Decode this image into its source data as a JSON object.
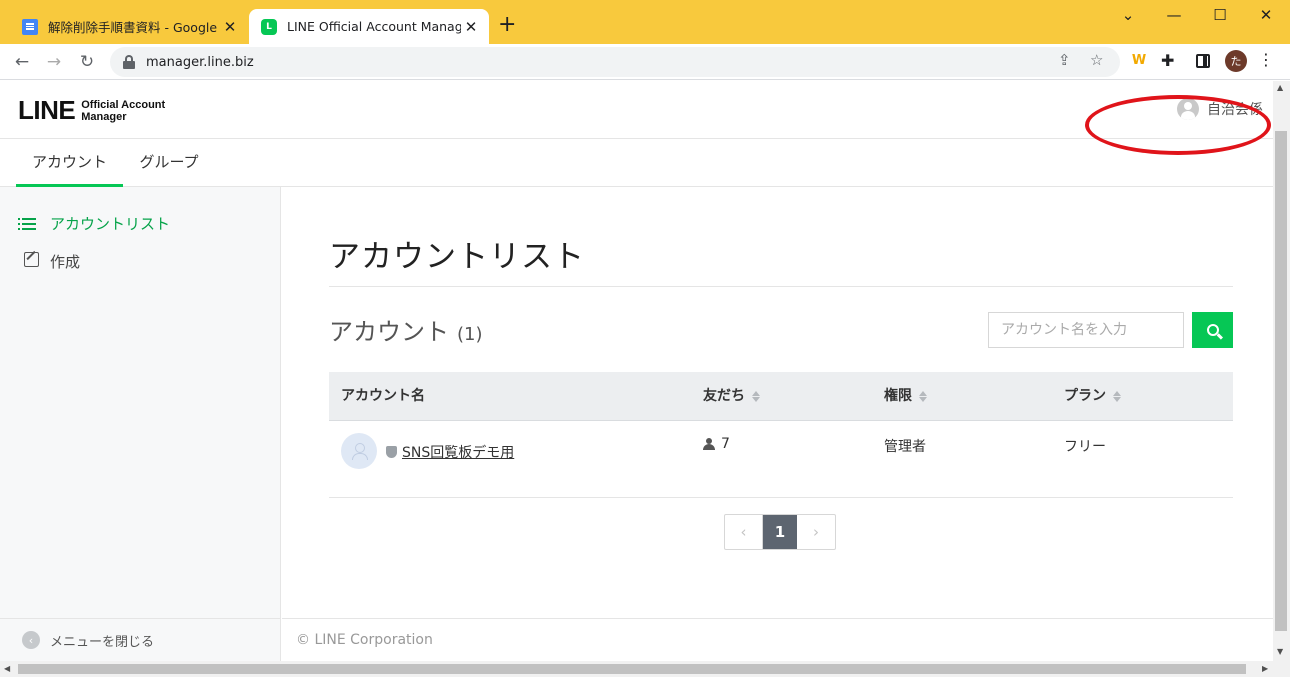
{
  "browser": {
    "tabs": [
      {
        "title": "解除削除手順書資料 - Google ドキ",
        "icon": "google-docs-icon",
        "active": false
      },
      {
        "title": "LINE Official Account Manager",
        "icon": "line-icon",
        "active": true
      }
    ],
    "new_tab": "+",
    "url": "manager.line.biz",
    "profile_initial": "た",
    "ext_w": "W"
  },
  "header": {
    "logo": "LINE",
    "logo_sub_1": "Official Account",
    "logo_sub_2": "Manager",
    "user_name": "自治会係"
  },
  "nav_tabs": [
    {
      "label": "アカウント",
      "active": true
    },
    {
      "label": "グループ",
      "active": false
    }
  ],
  "sidebar": {
    "items": [
      {
        "label": "アカウントリスト",
        "icon": "list-icon",
        "active": true
      },
      {
        "label": "作成",
        "icon": "edit-icon",
        "active": false
      }
    ],
    "close_menu": "メニューを閉じる"
  },
  "main": {
    "title": "アカウントリスト",
    "section_title": "アカウント",
    "count": "(1)",
    "search": {
      "placeholder": "アカウント名を入力",
      "value": ""
    },
    "table": {
      "headers": [
        "アカウント名",
        "友だち",
        "権限",
        "プラン"
      ],
      "rows": [
        {
          "name": "SNS回覧板デモ用",
          "friends": "7",
          "role": "管理者",
          "plan": "フリー"
        }
      ]
    },
    "pagination": {
      "prev": "‹",
      "current": "1",
      "next": "›"
    }
  },
  "footer": {
    "copyright": "© LINE Corporation"
  },
  "colors": {
    "accent": "#06c755",
    "annotation": "#e0141a",
    "tabstrip": "#f8c93d"
  }
}
